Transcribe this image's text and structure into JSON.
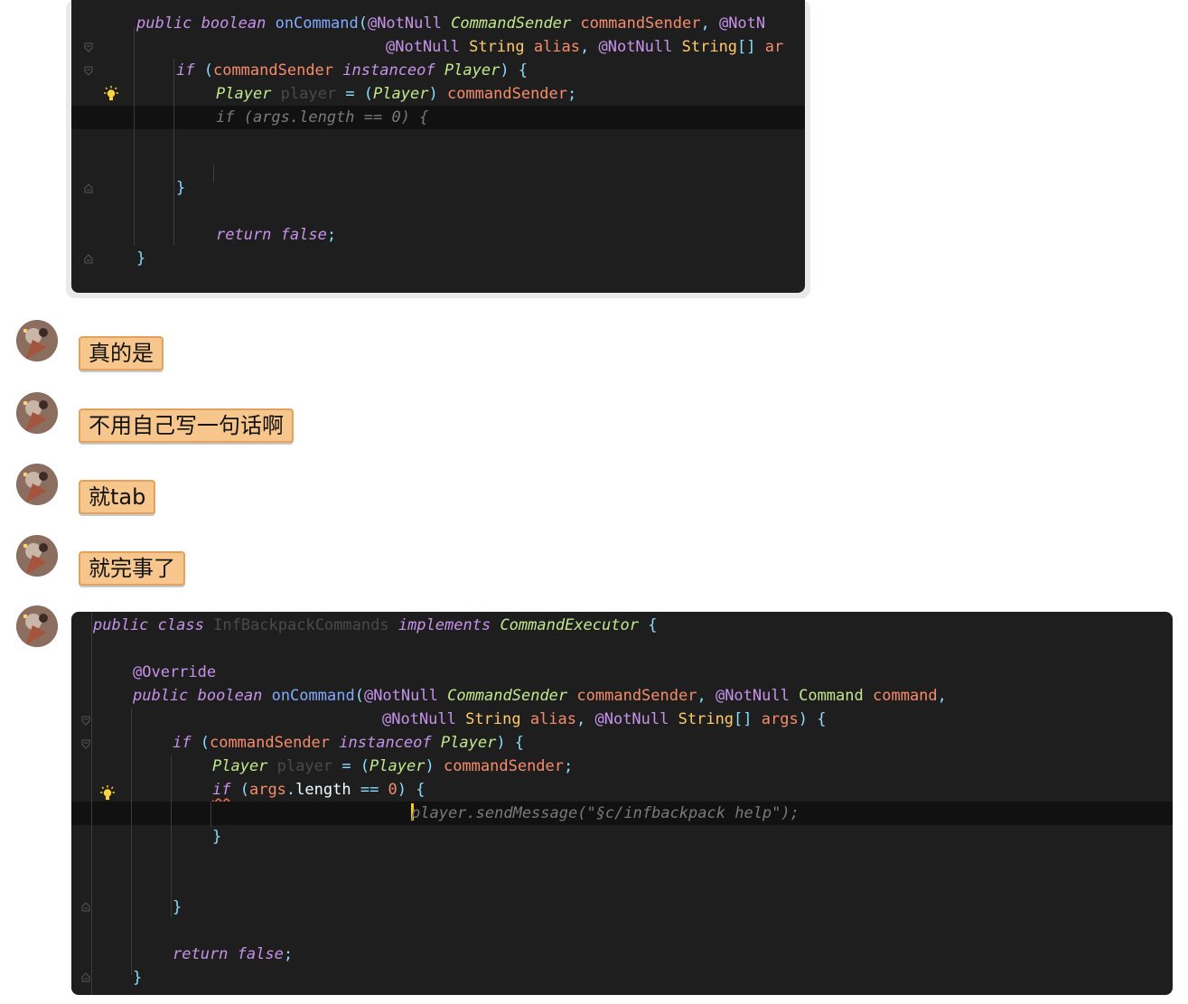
{
  "code_block_1": {
    "lines": [
      {
        "tokens": [
          {
            "t": "public",
            "c": "kw"
          },
          {
            "t": " ",
            "c": ""
          },
          {
            "t": "boolean",
            "c": "kw"
          },
          {
            "t": " ",
            "c": ""
          },
          {
            "t": "onCommand",
            "c": "fn"
          },
          {
            "t": "(",
            "c": "pl"
          },
          {
            "t": "@NotNull",
            "c": "an"
          },
          {
            "t": " ",
            "c": ""
          },
          {
            "t": "CommandSender",
            "c": "ty"
          },
          {
            "t": " ",
            "c": ""
          },
          {
            "t": "commandSender",
            "c": "pm"
          },
          {
            "t": ", ",
            "c": "pl"
          },
          {
            "t": "@NotN",
            "c": "an"
          }
        ]
      },
      {
        "tokens": [
          {
            "t": "@NotNull",
            "c": "an"
          },
          {
            "t": " ",
            "c": ""
          },
          {
            "t": "String",
            "c": "cls"
          },
          {
            "t": " ",
            "c": ""
          },
          {
            "t": "alias",
            "c": "pm"
          },
          {
            "t": ", ",
            "c": "pl"
          },
          {
            "t": "@NotNull",
            "c": "an"
          },
          {
            "t": " ",
            "c": ""
          },
          {
            "t": "String",
            "c": "cls"
          },
          {
            "t": "[] ",
            "c": "pl"
          },
          {
            "t": "ar",
            "c": "pm"
          }
        ]
      },
      {
        "tokens": [
          {
            "t": "if",
            "c": "kw"
          },
          {
            "t": " (",
            "c": "pl"
          },
          {
            "t": "commandSender",
            "c": "pm"
          },
          {
            "t": " ",
            "c": ""
          },
          {
            "t": "instanceof",
            "c": "kw"
          },
          {
            "t": " ",
            "c": ""
          },
          {
            "t": "Player",
            "c": "ty"
          },
          {
            "t": ") {",
            "c": "pl"
          }
        ]
      },
      {
        "tokens": [
          {
            "t": "Player",
            "c": "ty"
          },
          {
            "t": " ",
            "c": ""
          },
          {
            "t": "player",
            "c": "dim"
          },
          {
            "t": " = (",
            "c": "pl"
          },
          {
            "t": "Player",
            "c": "ty"
          },
          {
            "t": ") ",
            "c": "pl"
          },
          {
            "t": "commandSender",
            "c": "pm"
          },
          {
            "t": ";",
            "c": "pl"
          }
        ]
      },
      {
        "tokens": [
          {
            "t": "if (args.length == 0) {",
            "c": "gh"
          }
        ]
      },
      {
        "tokens": []
      },
      {
        "tokens": []
      },
      {
        "tokens": [
          {
            "t": "}",
            "c": "pl"
          }
        ]
      },
      {
        "tokens": []
      },
      {
        "tokens": [
          {
            "t": "return",
            "c": "kw"
          },
          {
            "t": " ",
            "c": ""
          },
          {
            "t": "false",
            "c": "kw"
          },
          {
            "t": ";",
            "c": "pl"
          }
        ]
      },
      {
        "tokens": [
          {
            "t": "}",
            "c": "pl"
          }
        ]
      }
    ]
  },
  "messages": [
    {
      "text": "真的是"
    },
    {
      "text": "不用自己写一句话啊"
    },
    {
      "text": "就tab"
    },
    {
      "text": "就完事了"
    }
  ],
  "code_block_2": {
    "lines": [
      {
        "tokens": [
          {
            "t": "public",
            "c": "kw"
          },
          {
            "t": " ",
            "c": ""
          },
          {
            "t": "class",
            "c": "kw"
          },
          {
            "t": " ",
            "c": ""
          },
          {
            "t": "InfBackpackCommands",
            "c": "dim"
          },
          {
            "t": " ",
            "c": ""
          },
          {
            "t": "implements",
            "c": "kw"
          },
          {
            "t": " ",
            "c": ""
          },
          {
            "t": "CommandExecutor",
            "c": "ty"
          },
          {
            "t": " {",
            "c": "pl"
          }
        ]
      },
      {
        "tokens": []
      },
      {
        "tokens": [
          {
            "t": "@Override",
            "c": "an"
          }
        ]
      },
      {
        "tokens": [
          {
            "t": "public",
            "c": "kw"
          },
          {
            "t": " ",
            "c": ""
          },
          {
            "t": "boolean",
            "c": "kw"
          },
          {
            "t": " ",
            "c": ""
          },
          {
            "t": "onCommand",
            "c": "fn"
          },
          {
            "t": "(",
            "c": "pl"
          },
          {
            "t": "@NotNull",
            "c": "an"
          },
          {
            "t": " ",
            "c": ""
          },
          {
            "t": "CommandSender",
            "c": "ty"
          },
          {
            "t": " ",
            "c": ""
          },
          {
            "t": "commandSender",
            "c": "pm"
          },
          {
            "t": ", ",
            "c": "pl"
          },
          {
            "t": "@NotNull",
            "c": "an"
          },
          {
            "t": " ",
            "c": ""
          },
          {
            "t": "Command",
            "c": "lbl"
          },
          {
            "t": " ",
            "c": ""
          },
          {
            "t": "command",
            "c": "pm"
          },
          {
            "t": ",",
            "c": "pl"
          }
        ]
      },
      {
        "tokens": [
          {
            "t": "@NotNull",
            "c": "an"
          },
          {
            "t": " ",
            "c": ""
          },
          {
            "t": "String",
            "c": "cls"
          },
          {
            "t": " ",
            "c": ""
          },
          {
            "t": "alias",
            "c": "pm"
          },
          {
            "t": ", ",
            "c": "pl"
          },
          {
            "t": "@NotNull",
            "c": "an"
          },
          {
            "t": " ",
            "c": ""
          },
          {
            "t": "String",
            "c": "cls"
          },
          {
            "t": "[] ",
            "c": "pl"
          },
          {
            "t": "args",
            "c": "pm"
          },
          {
            "t": ") {",
            "c": "pl"
          }
        ]
      },
      {
        "tokens": [
          {
            "t": "if",
            "c": "kw"
          },
          {
            "t": " (",
            "c": "pl"
          },
          {
            "t": "commandSender",
            "c": "pm"
          },
          {
            "t": " ",
            "c": ""
          },
          {
            "t": "instanceof",
            "c": "kw"
          },
          {
            "t": " ",
            "c": ""
          },
          {
            "t": "Player",
            "c": "ty"
          },
          {
            "t": ") {",
            "c": "pl"
          }
        ]
      },
      {
        "tokens": [
          {
            "t": "Player",
            "c": "ty"
          },
          {
            "t": " ",
            "c": ""
          },
          {
            "t": "player",
            "c": "dim"
          },
          {
            "t": " = (",
            "c": "pl"
          },
          {
            "t": "Player",
            "c": "ty"
          },
          {
            "t": ") ",
            "c": "pl"
          },
          {
            "t": "commandSender",
            "c": "pm"
          },
          {
            "t": ";",
            "c": "pl"
          }
        ]
      },
      {
        "tokens": [
          {
            "t": "if",
            "c": "kw"
          },
          {
            "t": " (",
            "c": "pl"
          },
          {
            "t": "args",
            "c": "pm"
          },
          {
            "t": ".",
            "c": "pl"
          },
          {
            "t": "length",
            "c": "txw"
          },
          {
            "t": " == ",
            "c": "pl"
          },
          {
            "t": "0",
            "c": "num"
          },
          {
            "t": ") {",
            "c": "pl"
          }
        ]
      },
      {
        "tokens": [
          {
            "t": "player.sendMessage(\"§c/infbackpack help\");",
            "c": "gh"
          }
        ]
      },
      {
        "tokens": [
          {
            "t": "}",
            "c": "pl"
          }
        ]
      },
      {
        "tokens": []
      },
      {
        "tokens": []
      },
      {
        "tokens": [
          {
            "t": "}",
            "c": "pl"
          }
        ]
      },
      {
        "tokens": []
      },
      {
        "tokens": [
          {
            "t": "return",
            "c": "kw"
          },
          {
            "t": " ",
            "c": ""
          },
          {
            "t": "false",
            "c": "kw"
          },
          {
            "t": ";",
            "c": "pl"
          }
        ]
      },
      {
        "tokens": [
          {
            "t": "}",
            "c": "pl"
          }
        ]
      }
    ]
  },
  "icons": {
    "fold": "fold-marker-icon",
    "bulb": "lightbulb-icon",
    "avatar": "user-avatar"
  }
}
